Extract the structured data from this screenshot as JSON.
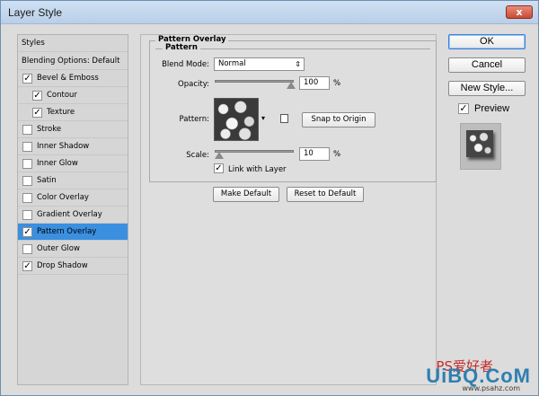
{
  "window": {
    "title": "Layer Style",
    "close_label": "x"
  },
  "styles_panel": {
    "header": "Styles",
    "blending_options": "Blending Options: Default",
    "items": [
      {
        "label": "Bevel & Emboss",
        "checked": true,
        "indent": false,
        "selected": false
      },
      {
        "label": "Contour",
        "checked": true,
        "indent": true,
        "selected": false
      },
      {
        "label": "Texture",
        "checked": true,
        "indent": true,
        "selected": false
      },
      {
        "label": "Stroke",
        "checked": false,
        "indent": false,
        "selected": false
      },
      {
        "label": "Inner Shadow",
        "checked": false,
        "indent": false,
        "selected": false
      },
      {
        "label": "Inner Glow",
        "checked": false,
        "indent": false,
        "selected": false
      },
      {
        "label": "Satin",
        "checked": false,
        "indent": false,
        "selected": false
      },
      {
        "label": "Color Overlay",
        "checked": false,
        "indent": false,
        "selected": false
      },
      {
        "label": "Gradient Overlay",
        "checked": false,
        "indent": false,
        "selected": false
      },
      {
        "label": "Pattern Overlay",
        "checked": true,
        "indent": false,
        "selected": true
      },
      {
        "label": "Outer Glow",
        "checked": false,
        "indent": false,
        "selected": false
      },
      {
        "label": "Drop Shadow",
        "checked": true,
        "indent": false,
        "selected": false
      }
    ]
  },
  "pattern_overlay": {
    "section_title": "Pattern Overlay",
    "group_title": "Pattern",
    "blend_mode_label": "Blend Mode:",
    "blend_mode_value": "Normal",
    "opacity_label": "Opacity:",
    "opacity_value": "100",
    "opacity_unit": "%",
    "pattern_label": "Pattern:",
    "snap_button": "Snap to Origin",
    "scale_label": "Scale:",
    "scale_value": "10",
    "scale_unit": "%",
    "link_label": "Link with Layer",
    "link_checked": true,
    "make_default_button": "Make Default",
    "reset_default_button": "Reset to Default"
  },
  "actions": {
    "ok": "OK",
    "cancel": "Cancel",
    "new_style": "New Style...",
    "preview_label": "Preview",
    "preview_checked": true
  },
  "watermark": {
    "logo": "UiBQ.CoM",
    "cn_text": "PS爱好者",
    "url": "www.psahz.com"
  },
  "colors": {
    "selection": "#3a8fe0",
    "dialog_bg": "#dcdcdc",
    "titlebar": "#c3d6ee",
    "close": "#c94a34"
  }
}
